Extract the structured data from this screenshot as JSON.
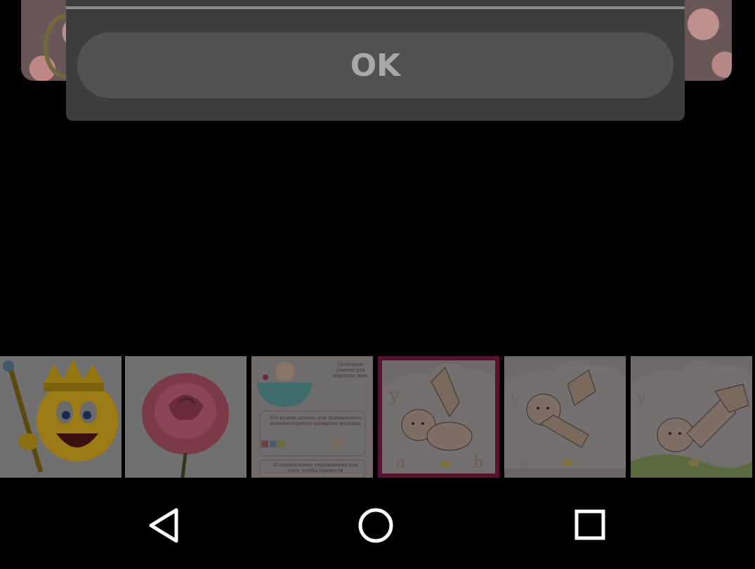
{
  "dialog": {
    "ok_label": "OK"
  },
  "thumbnails": [
    {
      "name": "emoji-king",
      "selected": false
    },
    {
      "name": "pink-rose",
      "selected": false
    },
    {
      "name": "baby-tips-poster",
      "selected": false,
      "texts": [
        "Полезные советы для хороших мам",
        "Что нужно делать для нормального психомоторного развития малыша",
        "И специальные упражнения для того, чтобы привести"
      ]
    },
    {
      "name": "baby-massage-1",
      "selected": true
    },
    {
      "name": "baby-massage-2",
      "selected": false
    },
    {
      "name": "baby-massage-3",
      "selected": false
    }
  ],
  "navbar": {
    "back": "back-icon",
    "home": "home-icon",
    "recents": "recents-icon"
  },
  "colors": {
    "scrim_background": "#000000",
    "dialog_background": "#3d3d3d",
    "button_background": "#525252",
    "button_text": "#a8a8a8",
    "selected_border": "#5a1030"
  }
}
